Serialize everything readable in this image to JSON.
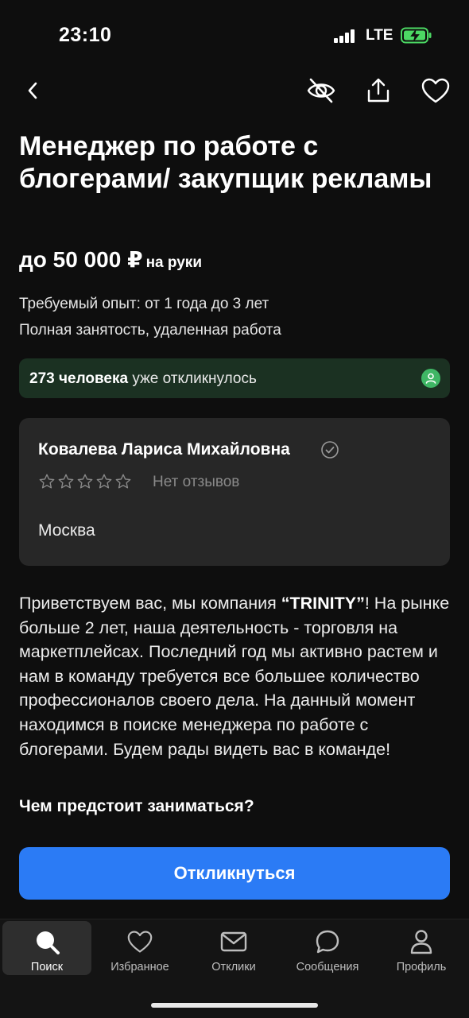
{
  "status": {
    "time": "23:10",
    "network": "LTE"
  },
  "vacancy": {
    "title": "Менеджер по работе с блогерами/ закупщик рекламы",
    "salary": "до 50 000 ₽",
    "salary_note": "на руки",
    "experience": "Требуемый опыт: от 1 года до 3 лет",
    "employment": "Полная занятость, удаленная работа"
  },
  "responses": {
    "count": "273 человека",
    "suffix": "уже откликнулось"
  },
  "employer": {
    "name": "Ковалева Лариса Михайловна",
    "rating_stars": 0,
    "reviews": "Нет отзывов",
    "city": "Москва"
  },
  "description": {
    "part1": "Приветствуем вас, мы компания ",
    "company": "“TRINITY”",
    "part2": "! На рынке больше 2 лет, наша деятельность - торговля на маркетплейсах. Последний год мы активно растем и нам в команду требуется все большее количество профессионалов своего дела. На данный момент находимся в поиске менеджера по работе с блогерами. Будем рады видеть вас в команде!"
  },
  "section_title": "Чем предстоит заниматься?",
  "apply_label": "Откликнуться",
  "colors": {
    "accent": "#2b7bf5",
    "success": "#3fb665",
    "background": "#0e0e0e",
    "card": "#272727"
  },
  "tabs": [
    {
      "label": "Поиск",
      "icon": "search-icon",
      "active": true
    },
    {
      "label": "Избранное",
      "icon": "heart-icon",
      "active": false
    },
    {
      "label": "Отклики",
      "icon": "mail-icon",
      "active": false
    },
    {
      "label": "Сообщения",
      "icon": "chat-icon",
      "active": false
    },
    {
      "label": "Профиль",
      "icon": "person-icon",
      "active": false
    }
  ]
}
